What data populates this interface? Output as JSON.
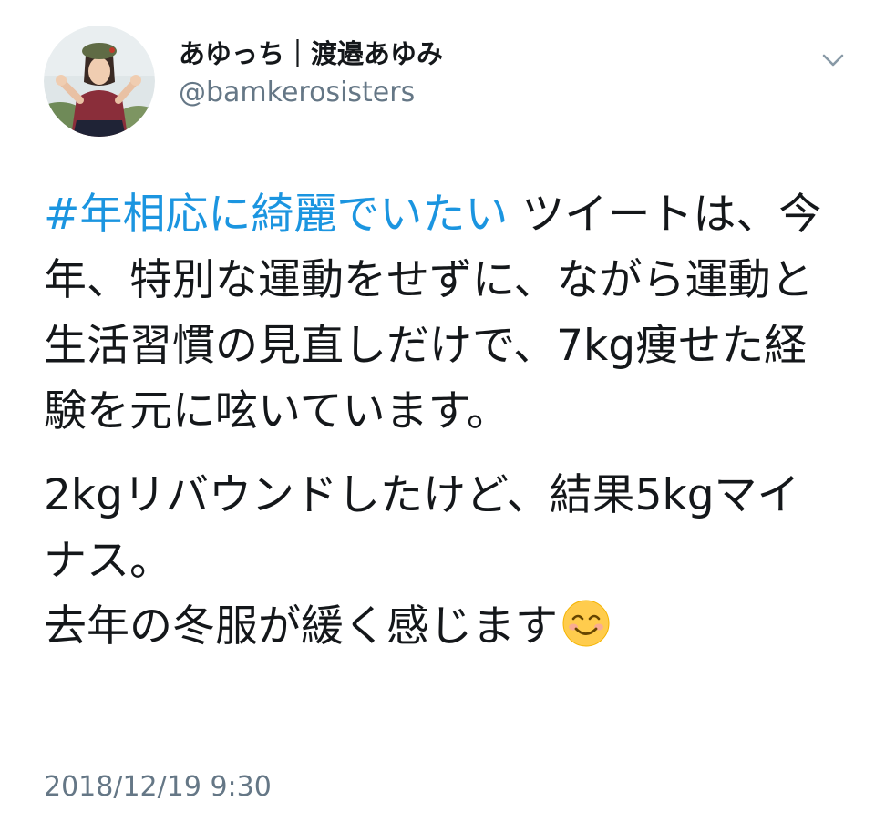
{
  "author": {
    "display_name": "あゆっち｜渡邉あゆみ",
    "handle": "@bamkerosisters"
  },
  "menu_icon": "chevron-down-icon",
  "tweet": {
    "hashtag": "#年相応に綺麗でいたい",
    "p1_rest": " ツイートは、今年、特別な運動をせずに、ながら運動と生活習慣の見直しだけで、7kg痩せた経験を元に呟いています。",
    "p2_line1": "2kgリバウンドしたけど、結果5kgマイナス。",
    "p2_line2": "去年の冬服が緩く感じます",
    "emoji": "smiling-face-emoji"
  },
  "timestamp": "2018/12/19 9:30",
  "colors": {
    "hashtag": "#1b95e0",
    "secondary_text": "#657786",
    "primary_text": "#14171a"
  }
}
